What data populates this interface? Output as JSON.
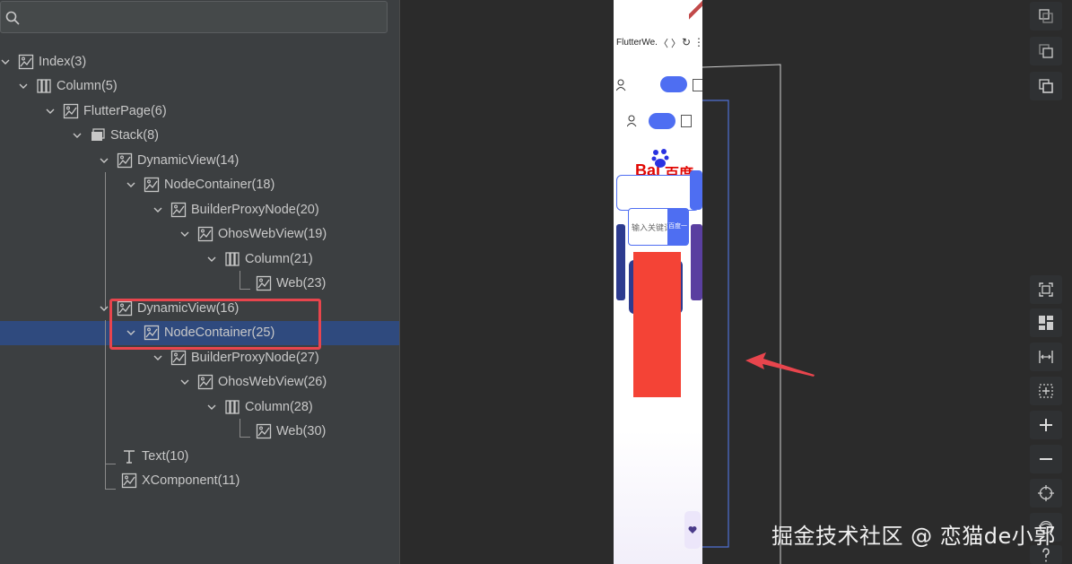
{
  "search": {
    "placeholder": "",
    "value": ""
  },
  "tree": {
    "nodes": [
      {
        "label": "Index(3)",
        "icon": "component-icon"
      },
      {
        "label": "Column(5)",
        "icon": "column-icon"
      },
      {
        "label": "FlutterPage(6)",
        "icon": "component-icon"
      },
      {
        "label": "Stack(8)",
        "icon": "stack-icon"
      },
      {
        "label": "DynamicView(14)",
        "icon": "component-icon"
      },
      {
        "label": "NodeContainer(18)",
        "icon": "component-icon"
      },
      {
        "label": "BuilderProxyNode(20)",
        "icon": "component-icon"
      },
      {
        "label": "OhosWebView(19)",
        "icon": "component-icon"
      },
      {
        "label": "Column(21)",
        "icon": "column-icon"
      },
      {
        "label": "Web(23)",
        "icon": "component-icon"
      },
      {
        "label": "DynamicView(16)",
        "icon": "component-icon"
      },
      {
        "label": "NodeContainer(25)",
        "icon": "component-icon",
        "selected": true
      },
      {
        "label": "BuilderProxyNode(27)",
        "icon": "component-icon"
      },
      {
        "label": "OhosWebView(26)",
        "icon": "component-icon"
      },
      {
        "label": "Column(28)",
        "icon": "column-icon"
      },
      {
        "label": "Web(30)",
        "icon": "component-icon"
      },
      {
        "label": "Text(10)",
        "icon": "text-icon"
      },
      {
        "label": "XComponent(11)",
        "icon": "component-icon"
      }
    ]
  },
  "phone": {
    "title": "FlutterWe...",
    "nav_prev": "〈",
    "nav_next": "〉",
    "reload": "↻",
    "menu": "⋮",
    "logo_bai": "Bai",
    "logo_du": "百度",
    "input_placeholder": "输入关键词",
    "search_button": "百度一下"
  },
  "toolbar": {
    "buttons": [
      "copy-top-icon",
      "copy-middle-icon",
      "copy-front-icon",
      "fit-screen-icon",
      "layout-icon",
      "fit-width-icon",
      "select-region-icon",
      "zoom-in-icon",
      "zoom-out-icon",
      "target-icon",
      "layers-icon",
      "help-icon"
    ]
  },
  "watermark": "掘金技术社区 @ 恋猫de小郭",
  "colors": {
    "selection": "#2f4a7e",
    "highlight": "#e8454d",
    "panel": "#3c3f41",
    "canvas": "#2b2b2b",
    "red_block": "#f44336"
  }
}
